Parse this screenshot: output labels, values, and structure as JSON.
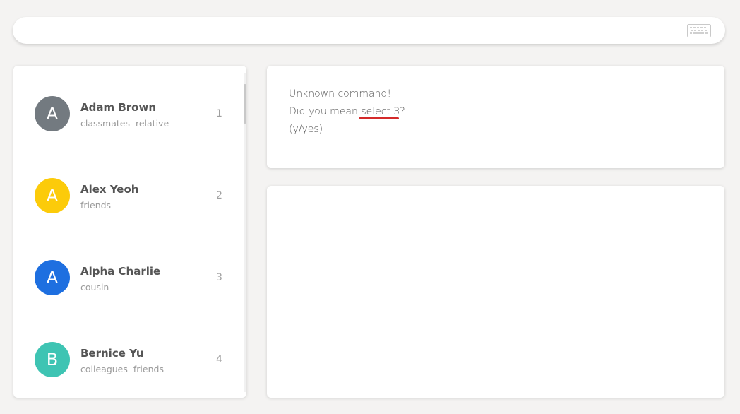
{
  "command_box": {
    "value": "",
    "placeholder": "",
    "icon": "keyboard-icon"
  },
  "person_list": {
    "items": [
      {
        "avatar_letter": "A",
        "avatar_color": "#737a80",
        "name": "Adam Brown",
        "tags": [
          "classmates",
          "relative"
        ],
        "index": "1"
      },
      {
        "avatar_letter": "A",
        "avatar_color": "#fccb0a",
        "name": "Alex Yeoh",
        "tags": [
          "friends"
        ],
        "index": "2"
      },
      {
        "avatar_letter": "A",
        "avatar_color": "#1e6fe0",
        "name": "Alpha Charlie",
        "tags": [
          "cousin"
        ],
        "index": "3"
      },
      {
        "avatar_letter": "B",
        "avatar_color": "#3ec4b3",
        "name": "Bernice Yu",
        "tags": [
          "colleagues",
          "friends"
        ],
        "index": "4"
      }
    ]
  },
  "result_display": {
    "line1": "Unknown command!",
    "line2_prefix": "Did you mean",
    "suggestion": " select 3",
    "line2_suffix": "?",
    "line3": "(y/yes)",
    "underline_color": "#d42a2a"
  },
  "detail_panel": {}
}
